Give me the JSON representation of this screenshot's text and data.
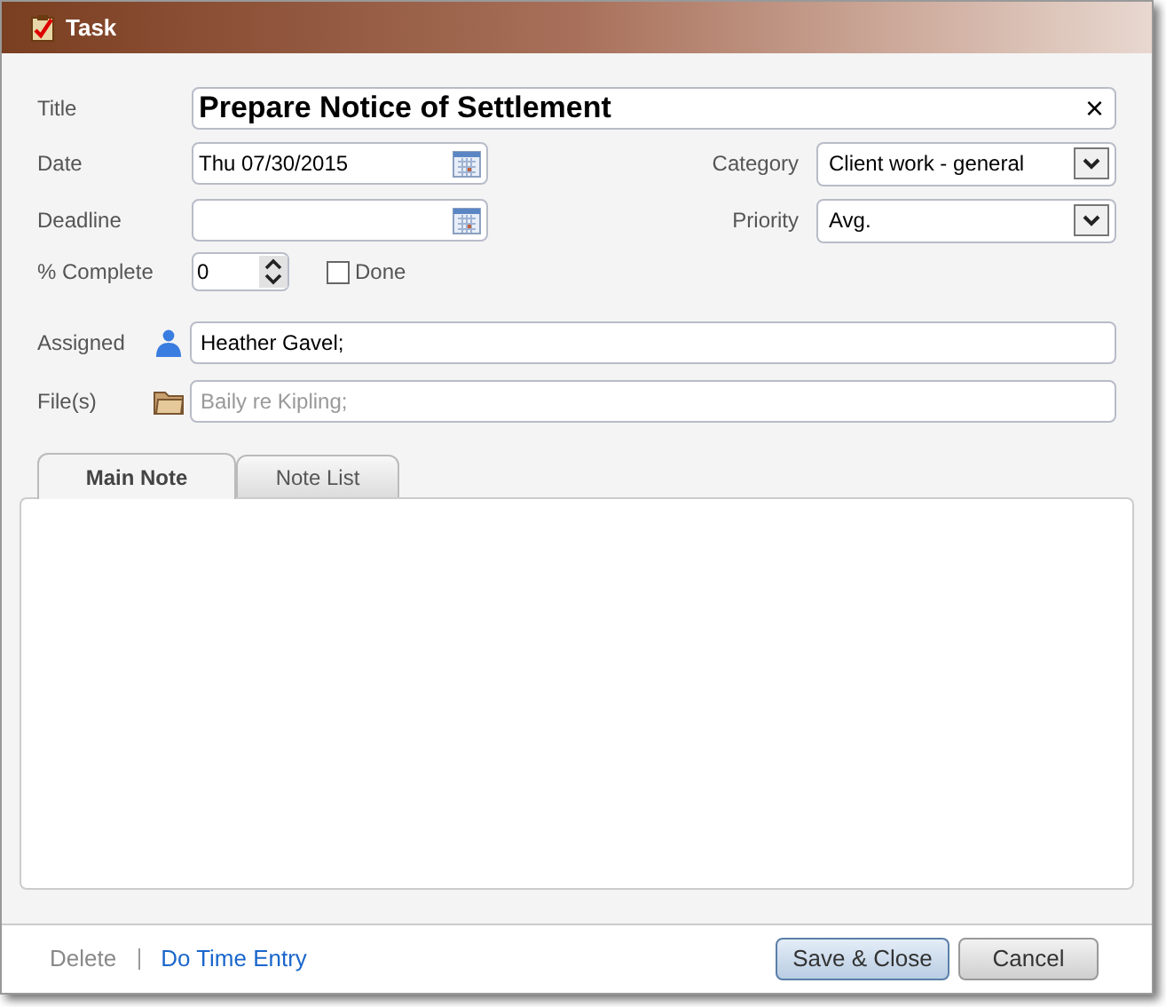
{
  "window": {
    "title": "Task"
  },
  "title": {
    "label": "Title",
    "value": "Prepare Notice of Settlement",
    "clear": "×"
  },
  "date": {
    "label": "Date",
    "value": "Thu 07/30/2015"
  },
  "category": {
    "label": "Category",
    "value": "Client work - general"
  },
  "deadline": {
    "label": "Deadline"
  },
  "priority": {
    "label": "Priority",
    "value": "Avg."
  },
  "complete": {
    "label": "% Complete",
    "value": "0"
  },
  "done": {
    "label": "Done",
    "checked": false
  },
  "assigned": {
    "label": "Assigned",
    "value": "Heather Gavel;"
  },
  "files": {
    "label": "File(s)",
    "placeholder": "Baily re Kipling;"
  },
  "tabs": [
    {
      "label": "Main Note",
      "selected": true
    },
    {
      "label": "Note List",
      "selected": false
    }
  ],
  "footer": {
    "delete": {
      "label": "Delete",
      "disabled": true
    },
    "time_entry": "Do Time Entry"
  },
  "buttons": [
    {
      "label": "Save & Close",
      "kind": "primary"
    },
    {
      "label": "Cancel",
      "kind": "secondary"
    }
  ]
}
